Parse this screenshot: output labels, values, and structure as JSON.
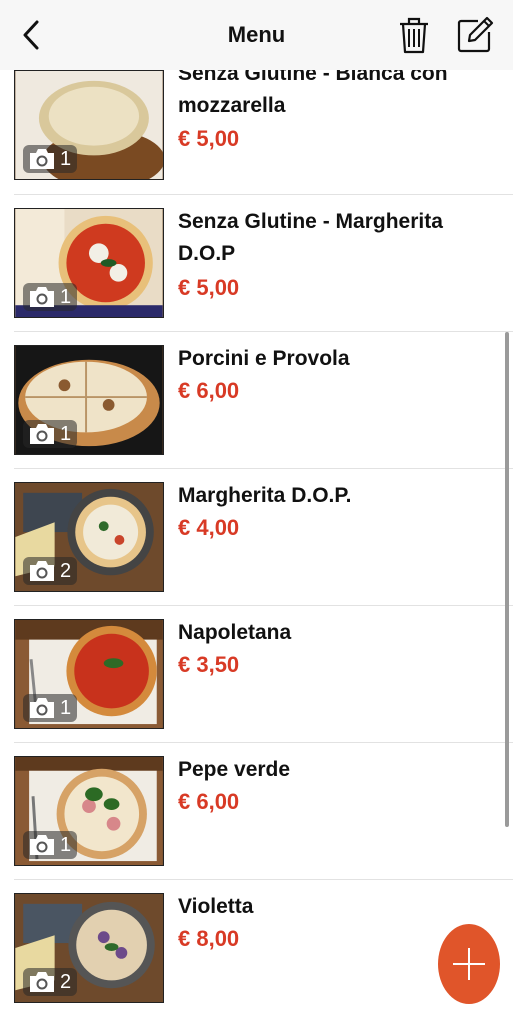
{
  "header": {
    "title": "Menu"
  },
  "items": [
    {
      "name": "Senza Glutine - Bianca con mozzarella",
      "price": "€ 5,00",
      "photo_count": "1"
    },
    {
      "name": "Senza Glutine - Margherita D.O.P",
      "price": "€ 5,00",
      "photo_count": "1"
    },
    {
      "name": "Porcini e Provola",
      "price": "€ 6,00",
      "photo_count": "1"
    },
    {
      "name": "Margherita D.O.P.",
      "price": "€ 4,00",
      "photo_count": "2"
    },
    {
      "name": "Napoletana",
      "price": "€ 3,50",
      "photo_count": "1"
    },
    {
      "name": "Pepe verde",
      "price": "€ 6,00",
      "photo_count": "1"
    },
    {
      "name": "Violetta",
      "price": "€ 8,00",
      "photo_count": "2"
    }
  ],
  "colors": {
    "price": "#d83a25",
    "fab": "#e0552a",
    "header_bg": "#f7f7f7"
  },
  "icons": {
    "back": "chevron-left-icon",
    "delete": "trash-icon",
    "edit": "edit-icon",
    "photo": "camera-icon",
    "add": "plus-icon"
  }
}
